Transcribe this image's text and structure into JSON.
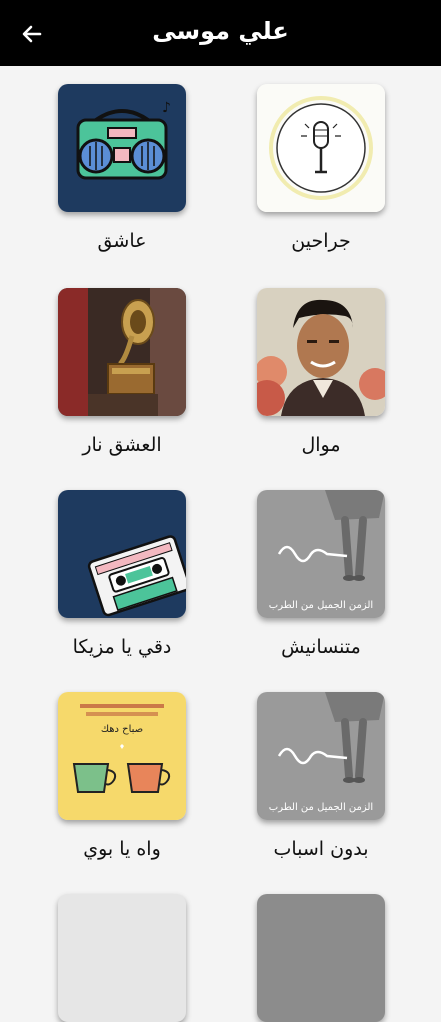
{
  "header": {
    "title": "علي موسى",
    "back_icon": "arrow-left-icon"
  },
  "songs": [
    {
      "title": "جراحين",
      "art": "microphone"
    },
    {
      "title": "عاشق",
      "art": "boombox"
    },
    {
      "title": "موال",
      "art": "singer-portrait"
    },
    {
      "title": "العشق نار",
      "art": "gramophone"
    },
    {
      "title": "متنسانيش",
      "art": "photo-woman-walking",
      "caption": "الزمن الجميل من الطرب"
    },
    {
      "title": "دقي يا مزيكا",
      "art": "cassette"
    },
    {
      "title": "بدون اسباب",
      "art": "photo-woman-walking",
      "caption": "الزمن الجميل من الطرب"
    },
    {
      "title": "واه يا بوي",
      "art": "coffee-cups",
      "caption": "صباح دهك"
    }
  ],
  "colors": {
    "appbar": "#000000",
    "background": "#f4f4f4",
    "navy": "#1e3a5f"
  }
}
